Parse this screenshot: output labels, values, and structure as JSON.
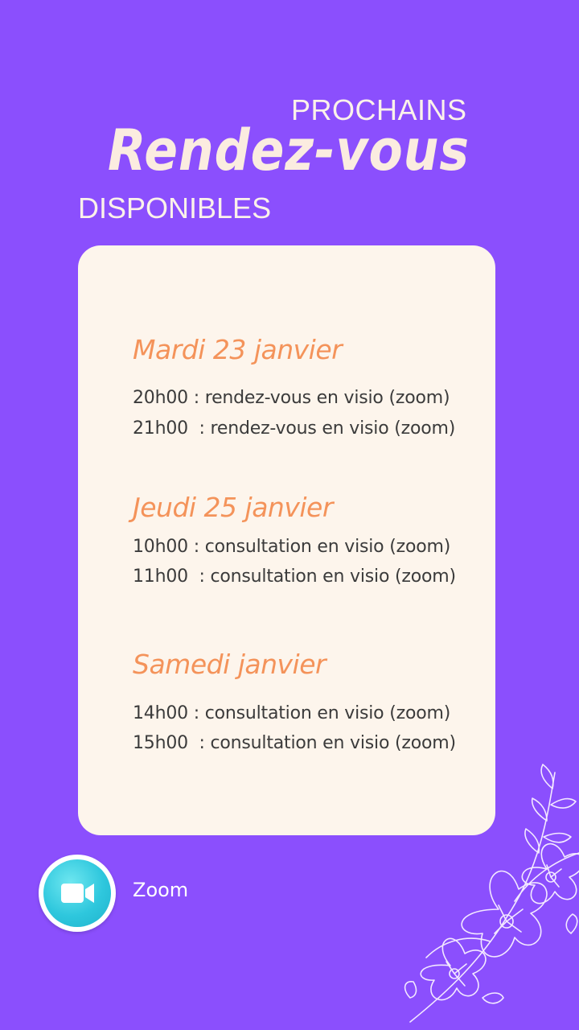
{
  "header": {
    "kicker_top": "PROCHAINS",
    "title": "Rendez-vous",
    "kicker_bottom": "DISPONIBLES"
  },
  "schedule": [
    {
      "day": "Mardi 23 janvier",
      "slots": [
        "20h00 : rendez-vous en visio (zoom)",
        "21h00  : rendez-vous en visio (zoom)"
      ]
    },
    {
      "day": "Jeudi 25 janvier",
      "slots": [
        "10h00 : consultation en visio (zoom)",
        "11h00  : consultation en visio (zoom)"
      ]
    },
    {
      "day": "Samedi  janvier",
      "slots": [
        "14h00 : consultation en visio (zoom)",
        "15h00  : consultation en visio (zoom)"
      ]
    }
  ],
  "platform": {
    "icon": "video-camera-icon",
    "label": "Zoom"
  },
  "colors": {
    "background": "#8b4ffd",
    "card": "#fdf5ec",
    "day_accent": "#f4935a",
    "zoom_icon": "#2ec7dd"
  }
}
